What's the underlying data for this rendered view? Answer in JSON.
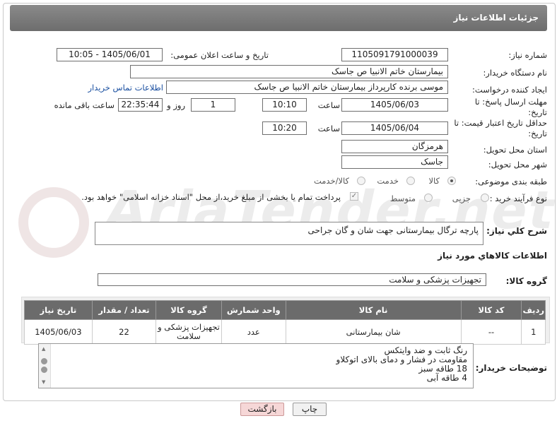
{
  "title": "جزئیات اطلاعات نیاز",
  "fields": {
    "need_number_label": "شماره نیاز:",
    "need_number": "1105091791000039",
    "announce_label": "تاریخ و ساعت اعلان عمومی:",
    "announce_value": "1405/06/01 - 10:05",
    "buyer_org_label": "نام دستگاه خریدار:",
    "buyer_org": "بیمارستان خاتم الانبیا  ص  جاسک",
    "creator_label": "ایجاد کننده درخواست:",
    "creator": "موسی  برنده کارپرداز بیمارستان خاتم الانبیا  ص  جاسک",
    "contact_link": "اطلاعات تماس خریدار",
    "deadline_label": "مهلت ارسال پاسخ: تا تاریخ:",
    "deadline_date": "1405/06/03",
    "time_label": "ساعت",
    "deadline_time": "10:10",
    "days_value": "1",
    "days_label": "روز و",
    "remaining_time": "22:35:44",
    "remaining_label": "ساعت باقی مانده",
    "price_valid_label": "حداقل تاریخ اعتبار قیمت: تا تاریخ:",
    "price_valid_date": "1405/06/04",
    "price_valid_time": "10:20",
    "province_label": "استان محل تحویل:",
    "province": "هرمزگان",
    "city_label": "شهر محل تحویل:",
    "city": "جاسک",
    "category_label": "طبقه بندی موضوعی:",
    "category_options": [
      "کالا",
      "خدمت",
      "کالا/خدمت"
    ],
    "category_selected": "کالا",
    "process_label": "نوع فرآیند خرید :",
    "process_options": [
      "جزیی",
      "متوسط"
    ],
    "payment_note": "پرداخت تمام یا بخشی از مبلغ خرید،از محل \"اسناد خزانه اسلامی\" خواهد بود.",
    "summary_label": "شرح کلي نياز:",
    "summary": "پارچه ترگال بیمارستانی جهت شان و گان جراحی",
    "goods_info_label": "اطلاعات کالاهاي مورد نياز",
    "goods_group_label": "گروه کالا:",
    "goods_group": "تجهیزات پزشکی و سلامت"
  },
  "table": {
    "headers": [
      "ردیف",
      "کد کالا",
      "نام کالا",
      "واحد شمارش",
      "گروه کالا",
      "تعداد / مقدار",
      "تاریخ نیاز"
    ],
    "rows": [
      [
        "1",
        "--",
        "شان بیمارستانی",
        "عدد",
        "تجهیزات پزشکی و سلامت",
        "22",
        "1405/06/03"
      ]
    ]
  },
  "buyer_notes_label": "توضیحات خریدار:",
  "buyer_notes": [
    "رنگ ثابت و ضد وایتکس",
    "مقاومت در فشار و دمای بالای اتوکلاو",
    "18 طاقه سبز",
    "4 طاقه آبی"
  ],
  "buttons": {
    "print": "چاپ",
    "back": "بازگشت"
  },
  "watermark": "AriaTender.net",
  "colors": {
    "titlebar": "#777777",
    "link": "#1a4fa0",
    "back_button": "#f6d7d7",
    "print_button": "#f1f1f1"
  }
}
